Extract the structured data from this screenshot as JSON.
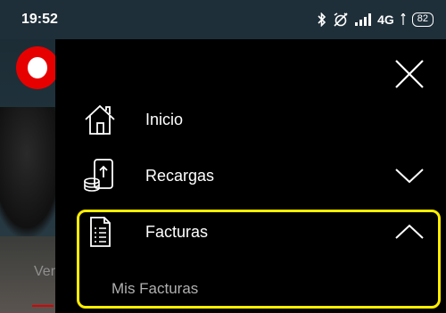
{
  "status_bar": {
    "time": "19:52",
    "network": "4G",
    "battery": "82",
    "icons": [
      "bluetooth-icon",
      "alarm-off-icon",
      "signal-icon",
      "battery-icon"
    ]
  },
  "background": {
    "visible_text": "Ver"
  },
  "drawer": {
    "close_icon": "close-icon",
    "items": [
      {
        "label": "Inicio",
        "icon": "home-icon",
        "expandable": false
      },
      {
        "label": "Recargas",
        "icon": "phone-topup-icon",
        "expandable": true,
        "expanded": false
      },
      {
        "label": "Facturas",
        "icon": "document-icon",
        "expandable": true,
        "expanded": true,
        "subitems": [
          {
            "label": "Mis Facturas"
          }
        ]
      }
    ]
  },
  "colors": {
    "drawer_bg": "#000000",
    "highlight": "#ffee00",
    "text": "#ffffff",
    "subtext": "#b0b0b0",
    "brand": "#e60000"
  }
}
